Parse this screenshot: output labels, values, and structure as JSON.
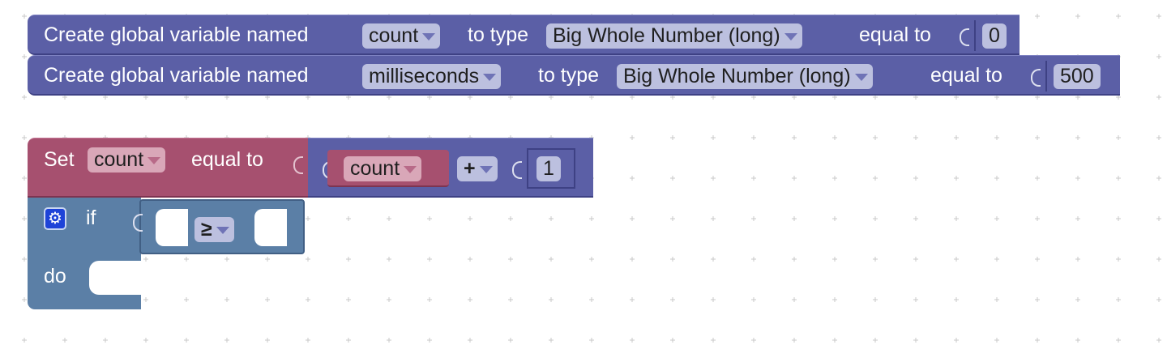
{
  "globals": [
    {
      "label_create": "Create global variable named",
      "var_name": "count",
      "label_type": "to type",
      "type_name": "Big Whole Number (long)",
      "label_equal": "equal to",
      "value": "0"
    },
    {
      "label_create": "Create global variable named",
      "var_name": "milliseconds",
      "label_type": "to type",
      "type_name": "Big Whole Number (long)",
      "label_equal": "equal to",
      "value": "500"
    }
  ],
  "set_block": {
    "label_set": "Set",
    "var_name": "count",
    "label_equal": "equal to"
  },
  "math_block": {
    "var_name": "count",
    "operator": "+",
    "value": "1"
  },
  "if_block": {
    "label_if": "if",
    "label_do": "do",
    "operator": "≥",
    "mutator_icon": "gear-icon"
  },
  "colors": {
    "variable_block": "#5b5fa6",
    "set_block": "#a6506f",
    "logic_block": "#5b7fa6",
    "background": "#ffffff"
  }
}
